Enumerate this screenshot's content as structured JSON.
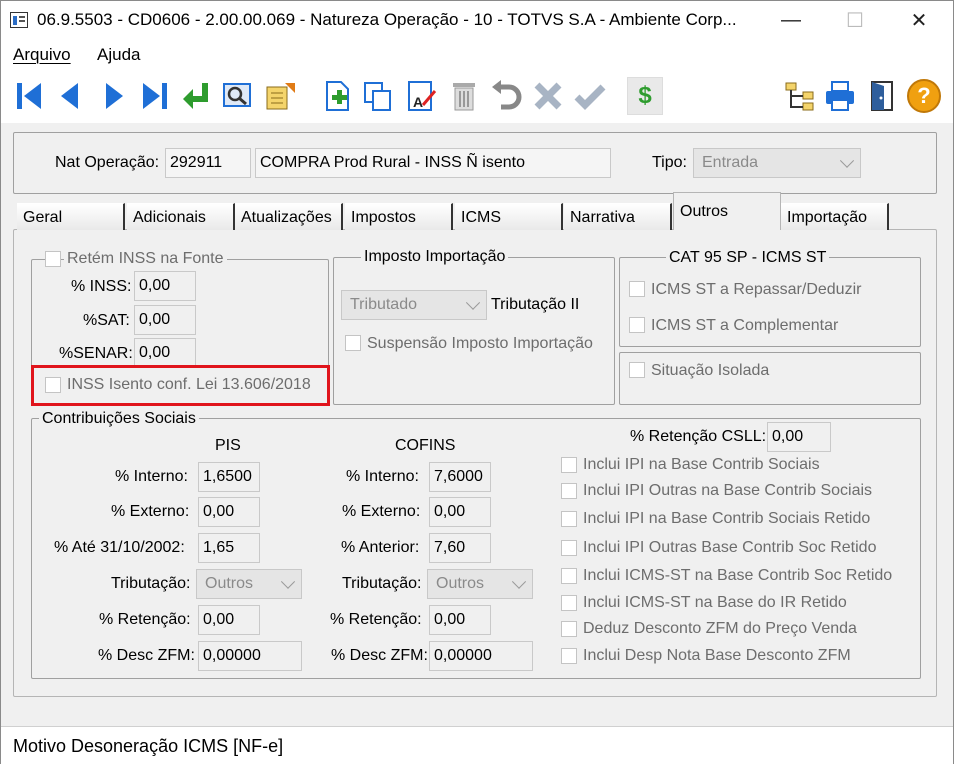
{
  "window": {
    "title": "06.9.5503 - CD0606 - 2.00.00.069 - Natureza Operação - 10 - TOTVS S.A - Ambiente Corp...",
    "minimize": "—",
    "maximize": "☐",
    "close": "✕"
  },
  "menu": {
    "items": [
      "Arquivo",
      "Ajuda"
    ]
  },
  "toolbar": {
    "icons": [
      "first-record-icon",
      "previous-record-icon",
      "next-record-icon",
      "last-record-icon",
      "return-icon",
      "search-icon",
      "report-icon",
      "new-record-icon",
      "copy-icon",
      "edit-icon",
      "delete-icon",
      "undo-icon",
      "cancel-icon",
      "confirm-icon",
      "dollar-icon",
      "tree-icon",
      "print-icon",
      "exit-icon",
      "help-icon"
    ],
    "dollar": "$",
    "help": "?"
  },
  "header": {
    "nat_label": "Nat Operação:",
    "nat_code": "292911",
    "nat_desc": "COMPRA Prod Rural - INSS Ñ isento",
    "tipo_label": "Tipo:",
    "tipo_value": "Entrada"
  },
  "tabs": [
    {
      "label": "Geral",
      "active": false
    },
    {
      "label": "Adicionais",
      "active": false
    },
    {
      "label": "Atualizações",
      "active": false
    },
    {
      "label": "Impostos",
      "active": false
    },
    {
      "label": "ICMS",
      "active": false
    },
    {
      "label": "Narrativa",
      "active": false
    },
    {
      "label": "Outros",
      "active": true
    },
    {
      "label": "Importação",
      "active": false
    }
  ],
  "inss": {
    "legend": "Retém INSS na Fonte",
    "inss_label": "% INSS:",
    "inss_value": "0,00",
    "sat_label": "%SAT:",
    "sat_value": "0,00",
    "senar_label": "%SENAR:",
    "senar_value": "0,00",
    "isento_label": "INSS Isento conf. Lei 13.606/2018"
  },
  "importacao": {
    "legend": "Imposto Importação",
    "tributacao_value": "Tributado",
    "tributacao_label": "Tributação II",
    "suspensao_label": "Suspensão Imposto Importação"
  },
  "cat95": {
    "legend": "CAT 95 SP - ICMS ST",
    "repassar_label": "ICMS ST a Repassar/Deduzir",
    "complementar_label": "ICMS ST a Complementar"
  },
  "situacao": {
    "label": "Situação Isolada"
  },
  "contribuicoes": {
    "legend": "Contribuições Sociais",
    "pis": {
      "title": "PIS",
      "interno_label": "% Interno:",
      "interno_value": "1,6500",
      "externo_label": "% Externo:",
      "externo_value": "0,00",
      "ate_label": "% Até 31/10/2002:",
      "ate_value": "1,65",
      "tributacao_label": "Tributação:",
      "tributacao_value": "Outros",
      "retencao_label": "% Retenção:",
      "retencao_value": "0,00",
      "desc_label": "% Desc ZFM:",
      "desc_value": "0,00000"
    },
    "cofins": {
      "title": "COFINS",
      "interno_label": "% Interno:",
      "interno_value": "7,6000",
      "externo_label": "% Externo:",
      "externo_value": "0,00",
      "anterior_label": "% Anterior:",
      "anterior_value": "7,60",
      "tributacao_label": "Tributação:",
      "tributacao_value": "Outros",
      "retencao_label": "% Retenção:",
      "retencao_value": "0,00",
      "desc_label": "% Desc ZFM:",
      "desc_value": "0,00000"
    },
    "csll_label": "% Retenção CSLL:",
    "csll_value": "0,00",
    "checks": [
      "Inclui IPI na Base Contrib Sociais",
      "Inclui IPI Outras na Base Contrib Sociais",
      "Inclui IPI na Base Contrib Sociais Retido",
      "Inclui IPI Outras Base Contrib Soc Retido",
      "Inclui ICMS-ST na Base Contrib Soc Retido",
      "Inclui ICMS-ST na Base do IR Retido",
      "Deduz Desconto ZFM do Preço Venda",
      "Inclui Desp Nota Base Desconto ZFM"
    ]
  },
  "status": {
    "text": "Motivo Desoneração ICMS [NF-e]"
  },
  "colors": {
    "highlight": "#e0141c",
    "toolbar_blue": "#1f6fd6",
    "help_orange": "#f0a010"
  }
}
